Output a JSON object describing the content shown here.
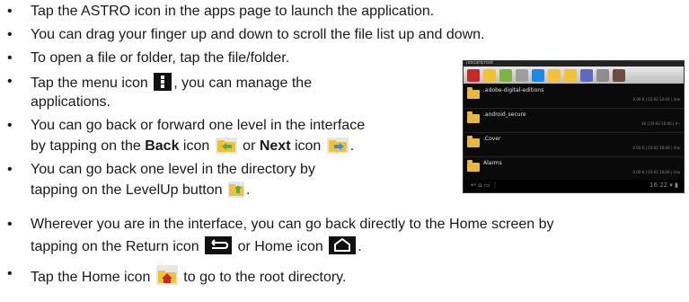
{
  "instructions": [
    {
      "text": "Tap the ASTRO icon in the apps page to launch the application."
    },
    {
      "text": "You can drag your finger up and down to scroll the file list up and down."
    },
    {
      "text": "To open a file or folder, tap the file/folder."
    },
    {
      "line1_pre": "Tap the menu icon",
      "line1_post": ", you can manage the",
      "line2": "applications."
    },
    {
      "line1": "You can go back or forward one level in the interface",
      "line2_pre": "by tapping on the",
      "back_label": "Back",
      "line2_mid1": " icon",
      "line2_mid2": " or",
      "next_label": "Next",
      "line2_mid3": " icon",
      "line2_post": "."
    },
    {
      "line1": "You can go back one level in the directory by",
      "line2_pre": "tapping on the LevelUp button",
      "line2_post": "."
    },
    {
      "line1": "Wherever you are in the interface, you can go back directly to the Home screen by",
      "line2_pre": "tapping on the Return icon",
      "line2_mid": " or Home icon",
      "line2_post": "."
    },
    {
      "line1_pre": "Tap the Home icon",
      "line1_post": " to go to the root directory."
    }
  ],
  "bullet_char": "•",
  "screenshot": {
    "status_text": "/sdcard/root",
    "files": [
      {
        "name": ".adobe-digital-editions",
        "meta": "0.00 K | 03-02 14:04 | drw"
      },
      {
        "name": ".android_secure",
        "meta": "40 | 03-02 16:06 | d--"
      },
      {
        "name": ".Cover",
        "meta": "0.00 K | 03-02 16:06 | drw"
      },
      {
        "name": "Alarms",
        "meta": "0.00 K | 03-01 18:06 | drw"
      }
    ],
    "nav_left": "↩   ⌂   ▭   ⋮",
    "nav_right": "16:22 ▾ ▮"
  }
}
